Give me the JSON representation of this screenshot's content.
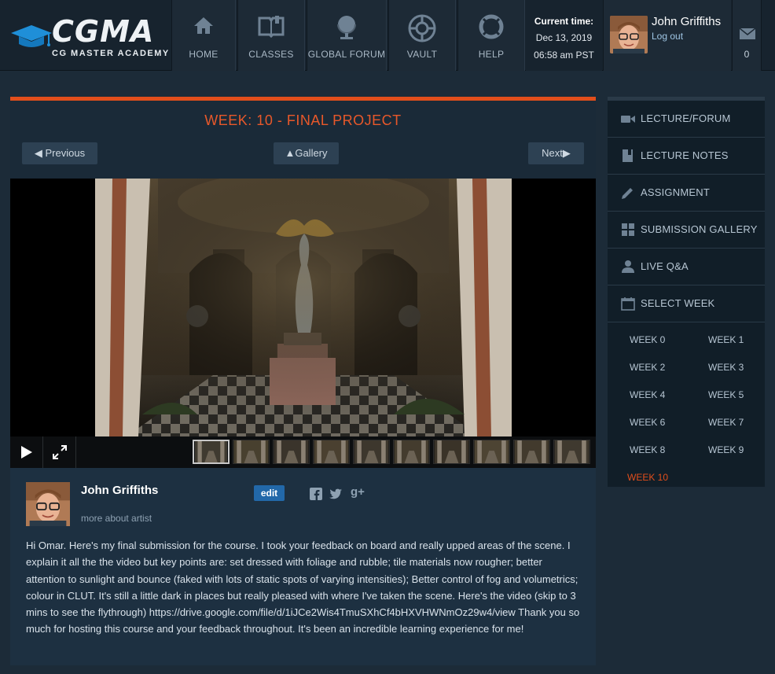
{
  "brand": {
    "logo_text": "CGMA",
    "subtitle": "CG MASTER ACADEMY"
  },
  "nav": [
    {
      "label": "HOME",
      "icon": "home-icon"
    },
    {
      "label": "CLASSES",
      "icon": "book-icon"
    },
    {
      "label": "GLOBAL FORUM",
      "icon": "globe-icon"
    },
    {
      "label": "VAULT",
      "icon": "vault-icon"
    },
    {
      "label": "HELP",
      "icon": "lifebuoy-icon"
    }
  ],
  "time": {
    "label": "Current time:",
    "date": "Dec 13, 2019",
    "clock": "06:58 am PST"
  },
  "user": {
    "name": "John Griffiths",
    "logout": "Log out"
  },
  "messages": {
    "count": "0",
    "icon": "mail-icon"
  },
  "main": {
    "title": "WEEK: 10 - FINAL PROJECT",
    "prev": "◀ Previous",
    "gallery": "▲Gallery",
    "next": "Next▶"
  },
  "player": {
    "play_icon": "play-icon",
    "fullscreen_icon": "fullscreen-icon",
    "thumb_count": 10
  },
  "artist": {
    "name": "John Griffiths",
    "more": "more about artist",
    "edit": "edit",
    "social": [
      "facebook-icon",
      "twitter-icon",
      "google-plus-icon"
    ],
    "description": "Hi Omar. Here's my final submission for the course. I took your feedback on board and really upped areas of the scene. I explain it all the the video but key points are: set dressed with foliage and rubble; tile materials now rougher; better attention to sunlight and bounce (faked with lots of static spots of varying intensities); Better control of fog and volumetrics; colour in CLUT. It's still a little dark in places but really pleased with where I've taken the scene. Here's the video (skip to 3 mins to see the flythrough) https://drive.google.com/file/d/1iJCe2Wis4TmuSXhCf4bHXVHWNmOz29w4/view Thank you so much for hosting this course and your feedback throughout. It's been an incredible learning experience for me!"
  },
  "sidebar": {
    "items": [
      {
        "label": "LECTURE/FORUM",
        "icon": "video-camera-icon"
      },
      {
        "label": "LECTURE NOTES",
        "icon": "notes-icon"
      },
      {
        "label": "ASSIGNMENT",
        "icon": "pencil-icon"
      },
      {
        "label": "SUBMISSION GALLERY",
        "icon": "grid-icon"
      },
      {
        "label": "LIVE Q&A",
        "icon": "person-icon"
      },
      {
        "label": "SELECT WEEK",
        "icon": "calendar-icon"
      }
    ],
    "weeks": [
      "WEEK 0",
      "WEEK 1",
      "WEEK 2",
      "WEEK 3",
      "WEEK 4",
      "WEEK 5",
      "WEEK 6",
      "WEEK 7",
      "WEEK 8",
      "WEEK 9",
      "WEEK 10"
    ],
    "active_week": "WEEK 10"
  },
  "colors": {
    "accent": "#e24e1b",
    "link": "#9fc6e4",
    "background": "#1c2b38",
    "sidebar": "#111e28"
  }
}
